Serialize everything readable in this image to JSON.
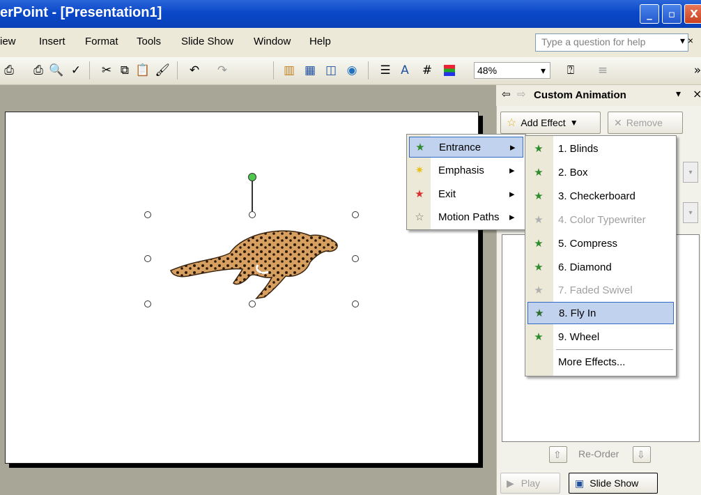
{
  "window": {
    "title": "erPoint - [Presentation1]",
    "min": "_",
    "max": "▫",
    "close": "X"
  },
  "menubar": {
    "items": [
      "iew",
      "Insert",
      "Format",
      "Tools",
      "Slide Show",
      "Window",
      "Help"
    ],
    "help_placeholder": "Type a question for help",
    "close_doc": "▾ ×"
  },
  "toolbar": {
    "zoom": "48%",
    "zoom_arrow": "▾",
    "icons": [
      "print-preview-icon",
      "print-icon",
      "preview-icon",
      "spelling-icon",
      "cut-icon",
      "copy-icon",
      "paste-icon",
      "format-painter-icon",
      "undo-icon",
      "redo-icon",
      "insert-chart-icon",
      "insert-table-icon",
      "tables-borders-icon",
      "hyperlink-icon",
      "expand-icon",
      "show-formatting-icon",
      "grid-icon",
      "color-icon",
      "help-icon",
      "more-icon"
    ]
  },
  "taskpane": {
    "title": "Custom Animation",
    "back": "⇦",
    "fwd": "⇨",
    "dropdown": "▾",
    "close": "×",
    "add_effect": "Add Effect",
    "remove": "Remove",
    "reorder": "Re-Order",
    "play": "Play",
    "slideshow": "Slide Show"
  },
  "effect_menu": {
    "items": [
      {
        "label": "Entrance",
        "mnemonic": "E",
        "arrow": "▸",
        "icon": "entrance-star-icon",
        "selected": true
      },
      {
        "label": "Emphasis",
        "mnemonic": "m",
        "arrow": "▸",
        "icon": "emphasis-star-icon"
      },
      {
        "label": "Exit",
        "mnemonic": "x",
        "arrow": "▸",
        "icon": "exit-star-icon"
      },
      {
        "label": "Motion Paths",
        "mnemonic": "P",
        "arrow": "▸",
        "icon": "motion-paths-icon"
      }
    ]
  },
  "entrance_menu": {
    "items": [
      {
        "label": "1. Blinds",
        "enabled": true
      },
      {
        "label": "2. Box",
        "enabled": true
      },
      {
        "label": "3. Checkerboard",
        "enabled": true
      },
      {
        "label": "4. Color Typewriter",
        "enabled": false
      },
      {
        "label": "5. Compress",
        "enabled": true
      },
      {
        "label": "6. Diamond",
        "enabled": true
      },
      {
        "label": "7. Faded Swivel",
        "enabled": false
      },
      {
        "label": "8. Fly In",
        "enabled": true,
        "selected": true
      },
      {
        "label": "9. Wheel",
        "enabled": true
      },
      {
        "label": "More Effects...",
        "enabled": true
      }
    ]
  },
  "colors": {
    "titlebar": "#0a48c8",
    "menu_bg": "#ece9d8",
    "selection": "#c1d2ee",
    "selection_border": "#316ac5",
    "star_green": "#2e8b2e",
    "star_yellow": "#f2d83a",
    "star_red": "#d83030"
  }
}
